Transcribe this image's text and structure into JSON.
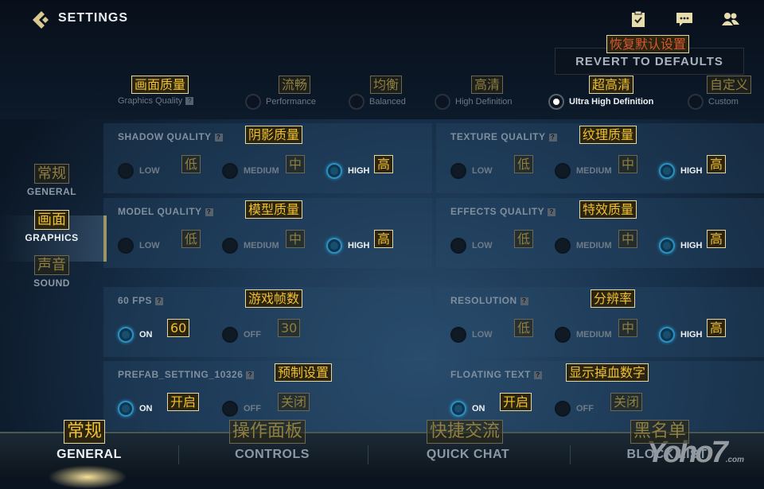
{
  "header": {
    "title": "SETTINGS",
    "revert_label": "REVERT TO DEFAULTS",
    "revert_cn": "恢复默认设置"
  },
  "graphics_quality": {
    "label": "Graphics Quality",
    "label_cn": "画面质量",
    "help": "?",
    "presets": [
      {
        "label": "Performance",
        "cn": "流畅",
        "selected": false
      },
      {
        "label": "Balanced",
        "cn": "均衡",
        "selected": false
      },
      {
        "label": "High Definition",
        "cn": "高清",
        "selected": false
      },
      {
        "label": "Ultra High Definition",
        "cn": "超高清",
        "selected": true
      },
      {
        "label": "Custom",
        "cn": "自定义",
        "selected": false
      }
    ]
  },
  "sidebar": {
    "items": [
      {
        "cn": "常规",
        "label": "GENERAL",
        "selected": false
      },
      {
        "cn": "画面",
        "label": "GRAPHICS",
        "selected": true
      },
      {
        "cn": "声音",
        "label": "SOUND",
        "selected": false
      }
    ]
  },
  "settings": [
    {
      "title": "SHADOW QUALITY",
      "cn": "阴影质量",
      "options": [
        {
          "label": "LOW",
          "cn": "低"
        },
        {
          "label": "MEDIUM",
          "cn": "中"
        },
        {
          "label": "HIGH",
          "cn": "高"
        }
      ],
      "selected": 2
    },
    {
      "title": "TEXTURE QUALITY",
      "cn": "纹理质量",
      "options": [
        {
          "label": "LOW",
          "cn": "低"
        },
        {
          "label": "MEDIUM",
          "cn": "中"
        },
        {
          "label": "HIGH",
          "cn": "高"
        }
      ],
      "selected": 2
    },
    {
      "title": "MODEL QUALITY",
      "cn": "模型质量",
      "options": [
        {
          "label": "LOW",
          "cn": "低"
        },
        {
          "label": "MEDIUM",
          "cn": "中"
        },
        {
          "label": "HIGH",
          "cn": "高"
        }
      ],
      "selected": 2
    },
    {
      "title": "EFFECTS QUALITY",
      "cn": "特效质量",
      "options": [
        {
          "label": "LOW",
          "cn": "低"
        },
        {
          "label": "MEDIUM",
          "cn": "中"
        },
        {
          "label": "HIGH",
          "cn": "高"
        }
      ],
      "selected": 2
    },
    {
      "title": "60 FPS",
      "cn": "游戏帧数",
      "options": [
        {
          "label": "ON",
          "cn": "60"
        },
        {
          "label": "OFF",
          "cn": "30"
        }
      ],
      "selected": 0
    },
    {
      "title": "RESOLUTION",
      "cn": "分辨率",
      "options": [
        {
          "label": "LOW",
          "cn": "低"
        },
        {
          "label": "MEDIUM",
          "cn": "中"
        },
        {
          "label": "HIGH",
          "cn": "高"
        }
      ],
      "selected": 2
    },
    {
      "title": "PREFAB_SETTING_10326",
      "cn": "预制设置",
      "options": [
        {
          "label": "ON",
          "cn": "开启"
        },
        {
          "label": "OFF",
          "cn": "关闭"
        }
      ],
      "selected": 0
    },
    {
      "title": "FLOATING TEXT",
      "cn": "显示掉血数字",
      "options": [
        {
          "label": "ON",
          "cn": "开启"
        },
        {
          "label": "OFF",
          "cn": "关闭"
        }
      ],
      "selected": 0
    }
  ],
  "tabs": [
    {
      "label": "GENERAL",
      "cn": "常规",
      "selected": true
    },
    {
      "label": "CONTROLS",
      "cn": "操作面板",
      "selected": false
    },
    {
      "label": "QUICK CHAT",
      "cn": "快捷交流",
      "selected": false
    },
    {
      "label": "BLOCK LIST",
      "cn": "黑名单",
      "selected": false
    }
  ],
  "watermark": {
    "text": "Yoho7",
    ".com": ".com"
  },
  "colors": {
    "accent": "#d9bf6a",
    "annotation": "#f0c030",
    "radio_selected": "#2a8fbf"
  }
}
